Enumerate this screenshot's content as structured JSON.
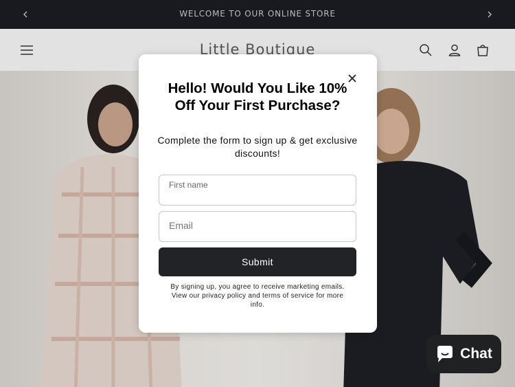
{
  "announcement": {
    "text": "WELCOME TO OUR ONLINE STORE",
    "prev_icon": "chevron-left-icon",
    "next_icon": "chevron-right-icon"
  },
  "header": {
    "logo": "Little Boutique",
    "menu_icon": "menu-icon",
    "search_icon": "search-icon",
    "account_icon": "account-icon",
    "cart_icon": "cart-icon"
  },
  "popup": {
    "title": "Hello! Would You Like 10% Off Your First Purchase?",
    "subtitle": "Complete the form to sign up & get exclusive discounts!",
    "first_name_placeholder": "First name",
    "email_placeholder": "Email",
    "submit_label": "Submit",
    "legal_text": "By signing up, you agree to receive marketing emails. View our privacy policy and terms of service for more info.",
    "close_icon": "close-icon"
  },
  "chat": {
    "label": "Chat",
    "icon": "chat-bubble-icon"
  },
  "colors": {
    "announcement_bg": "#1b1d22",
    "button_bg": "#222326",
    "chat_bg": "#1f2123"
  }
}
